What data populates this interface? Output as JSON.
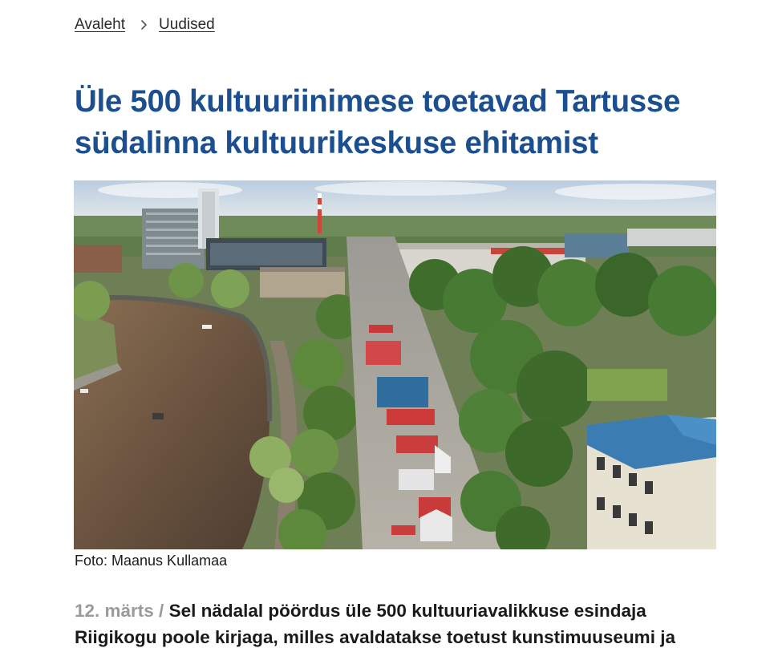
{
  "breadcrumb": {
    "home": "Avaleht",
    "current": "Uudised",
    "separator_icon": "chevron-right-icon"
  },
  "article": {
    "title": "Üle 500 kultuuriinimese toetavad Tartusse südalinna kultuurikeskuse ehitamist",
    "photo_caption": "Foto: Maanus Kullamaa",
    "date": "12. märts /",
    "lead": "Sel nädalal pöördus üle 500 kultuuriavalikkuse esindaja Riigikogu poole kirjaga, milles avaldatakse toetust kunstimuuseumi ja"
  },
  "colors": {
    "title": "#1b4f8f",
    "date": "#9a9a9a",
    "text": "#1a1a1a"
  }
}
